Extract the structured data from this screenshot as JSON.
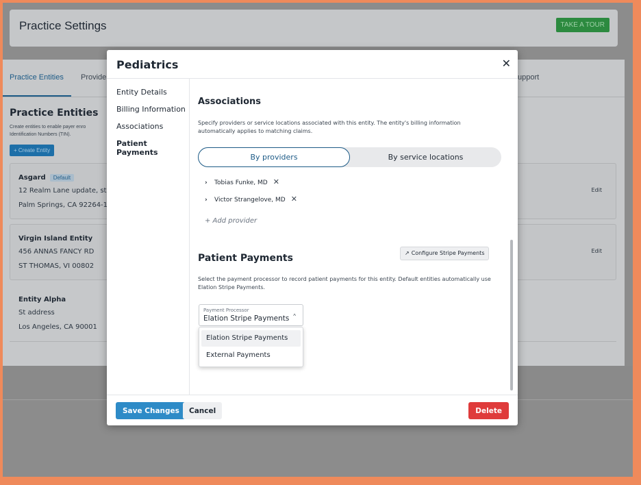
{
  "background": {
    "header_title": "Practice Settings",
    "tour_button": "TAKE A TOUR",
    "tabs": [
      {
        "label": "Practice Entities",
        "active": true
      },
      {
        "label": "Provide"
      }
    ],
    "support_tab": "upport",
    "section_title": "Practice Entities",
    "section_desc_line1": "Create entities to enable payer enro",
    "section_desc_line2": "Identification Numbers (TIN).",
    "create_button": "+ Create Entity",
    "edit_label": "Edit",
    "entities": [
      {
        "name": "Asgard",
        "badge": "Default",
        "line1": "12 Realm Lane update, st",
        "line2": "Palm Springs, CA 92264-1"
      },
      {
        "name": "Virgin Island Entity",
        "line1": "456 ANNAS FANCY RD",
        "line2": "ST THOMAS, VI 00802"
      },
      {
        "name": "Entity Alpha",
        "line1": "St address",
        "line2": "Los Angeles, CA 90001"
      }
    ]
  },
  "modal": {
    "title": "Pediatrics",
    "close_glyph": "✕",
    "nav": [
      {
        "label": "Entity Details"
      },
      {
        "label": "Billing Information"
      },
      {
        "label": "Associations"
      },
      {
        "label": "Patient Payments",
        "active": true
      }
    ],
    "associations": {
      "title": "Associations",
      "desc": "Specify providers or service locations associated with this entity. The entity's billing information automatically applies to matching claims.",
      "toggle": {
        "left": "By providers",
        "right": "By service locations",
        "selected": "By providers"
      },
      "providers": [
        "Tobias Funke, MD",
        "Victor Strangelove, MD"
      ],
      "add_provider": "+  Add provider"
    },
    "patient_payments": {
      "title": "Patient Payments",
      "configure_button": "Configure Stripe Payments",
      "desc": "Select the payment processor to record patient payments for this entity. Default entities automatically use Elation Stripe Payments.",
      "select_label": "Payment Processor",
      "select_value": "Elation Stripe Payments",
      "options": [
        "Elation Stripe Payments",
        "External Payments"
      ]
    },
    "footer": {
      "save": "Save Changes",
      "cancel": "Cancel",
      "delete": "Delete"
    }
  },
  "colors": {
    "accent": "#2e8bc7",
    "danger": "#df3b3b",
    "tour": "#2c8a3f",
    "frame_border": "#ef8a5b"
  }
}
